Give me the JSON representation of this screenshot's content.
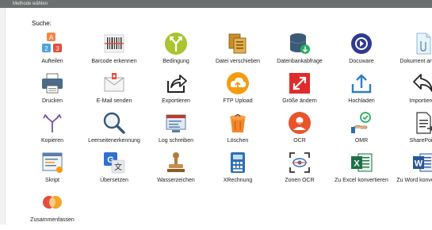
{
  "window": {
    "title": "Methode wählen"
  },
  "search": {
    "label": "Suche:"
  },
  "methods": [
    {
      "label": "Aufteilen",
      "icon": "split-blocks-icon"
    },
    {
      "label": "Barcode erkennen",
      "icon": "barcode-icon"
    },
    {
      "label": "Bedingung",
      "icon": "branch-icon"
    },
    {
      "label": "Datei verschieben",
      "icon": "move-file-icon"
    },
    {
      "label": "Datenbankabfrage",
      "icon": "database-icon"
    },
    {
      "label": "Docuware",
      "icon": "docuware-icon"
    },
    {
      "label": "Dokument anfügen",
      "icon": "attach-document-icon"
    },
    {
      "label": "Drucken",
      "icon": "printer-icon"
    },
    {
      "label": "E-Mail senden",
      "icon": "email-icon"
    },
    {
      "label": "Exportieren",
      "icon": "export-icon"
    },
    {
      "label": "FTP Upload",
      "icon": "cloud-upload-icon"
    },
    {
      "label": "Größe ändern",
      "icon": "resize-icon"
    },
    {
      "label": "Hochladen",
      "icon": "upload-icon"
    },
    {
      "label": "Importieren",
      "icon": "import-icon"
    },
    {
      "label": "Kopieren",
      "icon": "copy-fork-icon"
    },
    {
      "label": "Leerseitenerkennung",
      "icon": "magnifier-icon"
    },
    {
      "label": "Log schreiben",
      "icon": "log-icon"
    },
    {
      "label": "Löschen",
      "icon": "trash-icon"
    },
    {
      "label": "OCR",
      "icon": "ocr-icon"
    },
    {
      "label": "OMR",
      "icon": "omr-icon"
    },
    {
      "label": "SharePoint",
      "icon": "sharepoint-icon"
    },
    {
      "label": "Skript",
      "icon": "script-icon"
    },
    {
      "label": "Übersetzen",
      "icon": "translate-icon"
    },
    {
      "label": "Wasserzeichen",
      "icon": "stamp-icon"
    },
    {
      "label": "XRechnung",
      "icon": "calculator-icon"
    },
    {
      "label": "Zonen OCR",
      "icon": "zone-ocr-icon"
    },
    {
      "label": "Zu Excel konvertieren",
      "icon": "excel-icon"
    },
    {
      "label": "Zu Word konvertieren",
      "icon": "word-icon"
    },
    {
      "label": "Zusammenfassen",
      "icon": "merge-icon"
    }
  ]
}
